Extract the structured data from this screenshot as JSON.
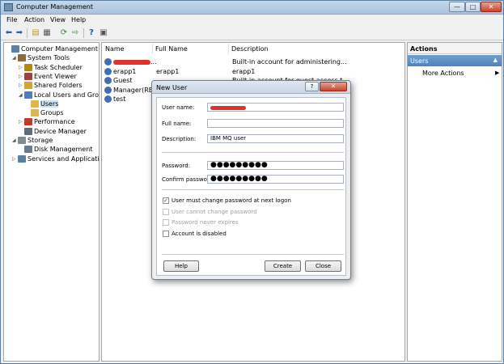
{
  "window": {
    "title": "Computer Management",
    "controls": {
      "minimize": "—",
      "maximize": "□",
      "close": "✕"
    }
  },
  "menu": [
    "File",
    "Action",
    "View",
    "Help"
  ],
  "toolbar": {
    "icons": [
      "back-arrow-icon",
      "forward-arrow-icon",
      "up-folder-icon",
      "show-hide-tree-icon",
      "refresh-icon",
      "export-list-icon",
      "help-icon",
      "properties-icon"
    ]
  },
  "tree": {
    "items": [
      {
        "label": "Computer Management (Local",
        "level": 0,
        "expander": "",
        "icon": "computer-icon"
      },
      {
        "label": "System Tools",
        "level": 1,
        "expander": "◢",
        "icon": "tools-icon"
      },
      {
        "label": "Task Scheduler",
        "level": 2,
        "expander": "▷",
        "icon": "clock-icon"
      },
      {
        "label": "Event Viewer",
        "level": 2,
        "expander": "▷",
        "icon": "event-viewer-icon"
      },
      {
        "label": "Shared Folders",
        "level": 2,
        "expander": "▷",
        "icon": "shared-folder-icon"
      },
      {
        "label": "Local Users and Groups",
        "level": 2,
        "expander": "◢",
        "icon": "users-group-icon"
      },
      {
        "label": "Users",
        "level": 3,
        "expander": "",
        "icon": "folder-icon",
        "selected": true
      },
      {
        "label": "Groups",
        "level": 3,
        "expander": "",
        "icon": "folder-icon"
      },
      {
        "label": "Performance",
        "level": 2,
        "expander": "▷",
        "icon": "performance-icon"
      },
      {
        "label": "Device Manager",
        "level": 2,
        "expander": "",
        "icon": "device-manager-icon"
      },
      {
        "label": "Storage",
        "level": 1,
        "expander": "◢",
        "icon": "storage-icon"
      },
      {
        "label": "Disk Management",
        "level": 2,
        "expander": "",
        "icon": "disk-icon"
      },
      {
        "label": "Services and Applications",
        "level": 1,
        "expander": "▷",
        "icon": "services-icon"
      }
    ]
  },
  "list": {
    "columns": [
      "Name",
      "Full Name",
      "Description"
    ],
    "rows": [
      {
        "name": "",
        "name_suffix": "...",
        "redacted": true,
        "full_name": "",
        "description": "Built-in account for administering..."
      },
      {
        "name": "erapp1",
        "full_name": "erapp1",
        "description": "erapp1"
      },
      {
        "name": "Guest",
        "full_name": "",
        "description": "Built-in account for guest access t..."
      },
      {
        "name": "Manager(RE...",
        "full_name": "",
        "description": ""
      },
      {
        "name": "test",
        "full_name": "",
        "description": ""
      }
    ]
  },
  "actions": {
    "title": "Actions",
    "section": "Users",
    "section_arrow": "▲",
    "more": "More Actions",
    "more_arrow": "▶"
  },
  "dialog": {
    "title": "New User",
    "help_glyph": "?",
    "close_glyph": "✕",
    "fields": {
      "user_name_label": "User name:",
      "user_name_value": "",
      "full_name_label": "Full name:",
      "full_name_value": "",
      "description_label": "Description:",
      "description_value": "IBM MQ user",
      "password_label": "Password:",
      "password_value": "●●●●●●●●●",
      "confirm_label": "Confirm password:",
      "confirm_value": "●●●●●●●●●"
    },
    "options": [
      {
        "label": "User must change password at next logon",
        "checked": true,
        "disabled": false
      },
      {
        "label": "User cannot change password",
        "checked": false,
        "disabled": true
      },
      {
        "label": "Password never expires",
        "checked": false,
        "disabled": true
      },
      {
        "label": "Account is disabled",
        "checked": false,
        "disabled": false
      }
    ],
    "check_glyph": "✓",
    "buttons": {
      "help": "Help",
      "create": "Create",
      "close": "Close"
    }
  }
}
